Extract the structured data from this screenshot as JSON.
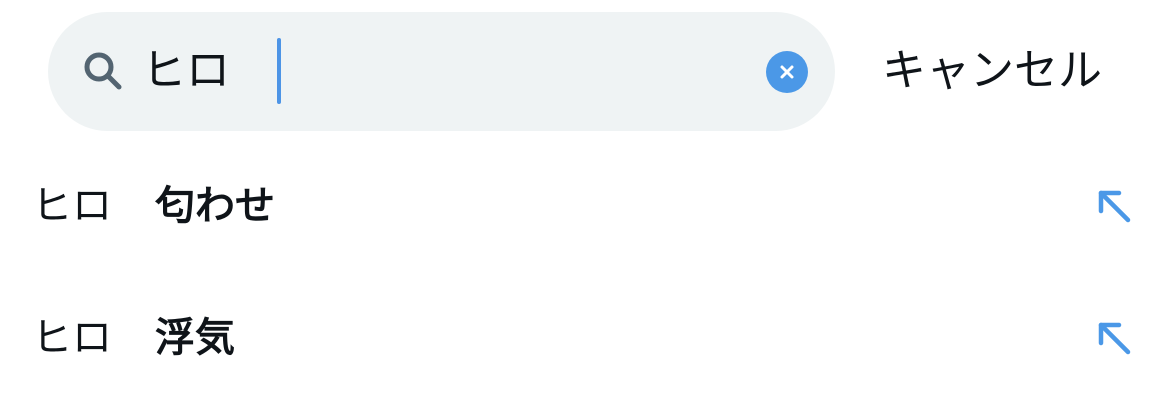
{
  "search": {
    "query": "ヒロ",
    "icon": "search-icon",
    "clear_icon": "clear-icon",
    "cancel_label": "キャンセル"
  },
  "suggestions": [
    {
      "prefix": "ヒロ",
      "term": "匂わせ",
      "icon": "arrow-up-left-icon"
    },
    {
      "prefix": "ヒロ",
      "term": "浮気",
      "icon": "arrow-up-left-icon"
    }
  ],
  "colors": {
    "search_background": "#eff3f4",
    "accent": "#4b98e7",
    "text": "#0f1419"
  }
}
